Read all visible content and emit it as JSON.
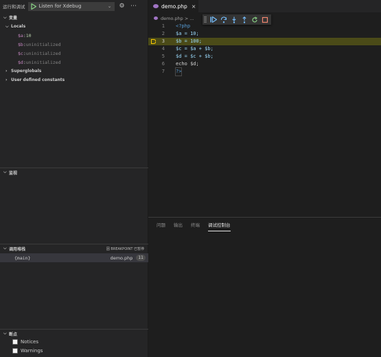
{
  "sidebar": {
    "run_title": "运行和调试",
    "config_name": "Listen for Xdebug",
    "variables": {
      "header": "变量",
      "locals_label": "Locals",
      "items": [
        {
          "name": "$a",
          "sep": ": ",
          "value": "10",
          "kind": "num"
        },
        {
          "name": "$b",
          "sep": ": ",
          "value": "uninitialized",
          "kind": "un"
        },
        {
          "name": "$c",
          "sep": ": ",
          "value": "uninitialized",
          "kind": "un"
        },
        {
          "name": "$d",
          "sep": ": ",
          "value": "uninitialized",
          "kind": "un"
        }
      ],
      "superglobals_label": "Superglobals",
      "constants_label": "User defined constants"
    },
    "watch": {
      "header": "监视"
    },
    "callstack": {
      "header": "调用堆栈",
      "status": "因 BREAKPOINT 已暂停",
      "frame": {
        "name": "{main}",
        "file": "demo.php",
        "line": "11"
      }
    },
    "breakpoints": {
      "header": "断点",
      "items": [
        {
          "label": "Notices"
        },
        {
          "label": "Warnings"
        }
      ]
    }
  },
  "editor": {
    "tab": {
      "label": "demo.php"
    },
    "breadcrumb": "demo.php > ...",
    "current_line": 3,
    "lines": [
      {
        "n": "1",
        "text": "<?php"
      },
      {
        "n": "2",
        "text": "$a = 10;"
      },
      {
        "n": "3",
        "text": "$b = 100;"
      },
      {
        "n": "4",
        "text": "$c = $a + $b;"
      },
      {
        "n": "5",
        "text": "$d = $c + $b;"
      },
      {
        "n": "6",
        "text": "echo $d;"
      },
      {
        "n": "7",
        "text": "?>"
      }
    ]
  },
  "panel": {
    "tabs": [
      {
        "label": "问题",
        "active": false
      },
      {
        "label": "输出",
        "active": false
      },
      {
        "label": "终端",
        "active": false
      },
      {
        "label": "调试控制台",
        "active": true
      }
    ]
  },
  "colors": {
    "accent_play": "#89d185",
    "breakpoint_arrow": "#ffcc00",
    "current_line_bg": "#4b4b18",
    "debug_blue": "#75beff",
    "debug_restart": "#89d185",
    "debug_stop": "#f48771"
  },
  "icons": {
    "start": "play-icon",
    "settings": "gear-icon",
    "more": "more-icon",
    "debug_toolbar": [
      "grip-icon",
      "continue-icon",
      "step-over-icon",
      "step-into-icon",
      "step-out-icon",
      "restart-icon",
      "stop-icon"
    ]
  }
}
